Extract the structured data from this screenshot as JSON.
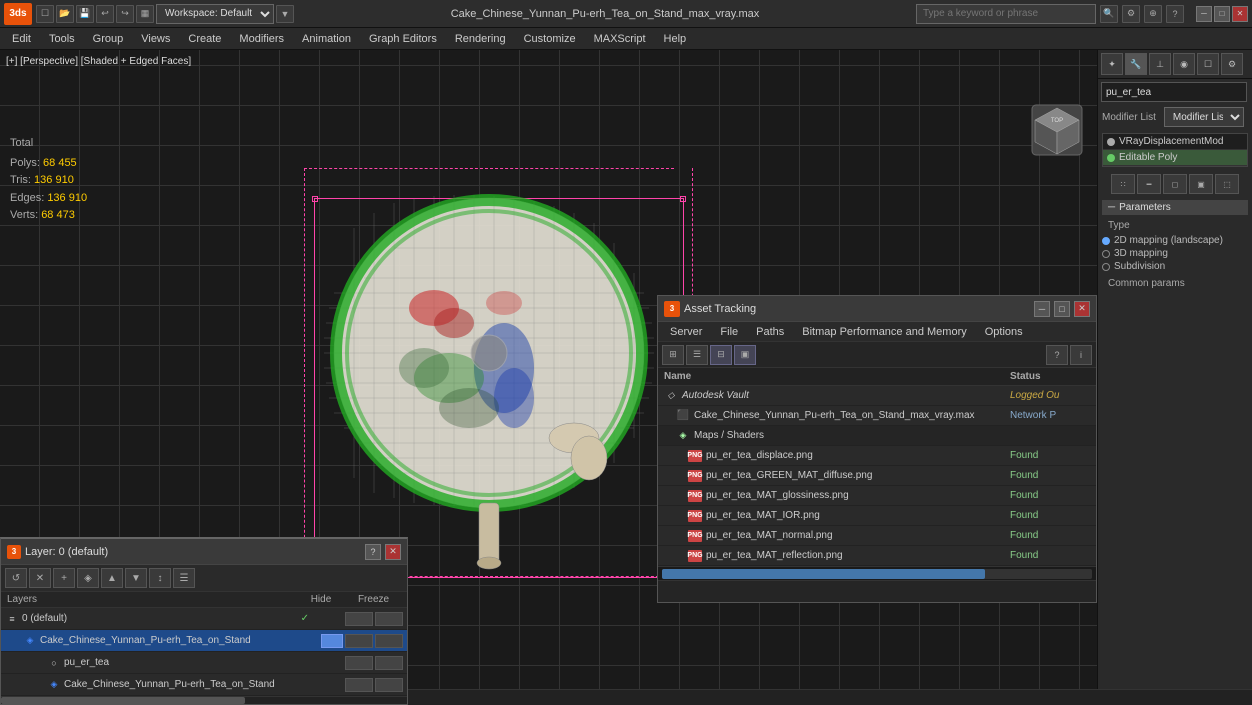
{
  "topbar": {
    "logo": "3ds",
    "workspace_label": "Workspace: Default",
    "file_title": "Cake_Chinese_Yunnan_Pu-erh_Tea_on_Stand_max_vray.max",
    "search_placeholder": "Type a keyword or phrase",
    "window_minimize": "─",
    "window_maximize": "□",
    "window_close": "✕"
  },
  "menubar": {
    "items": [
      {
        "label": "Edit"
      },
      {
        "label": "Tools"
      },
      {
        "label": "Group"
      },
      {
        "label": "Views"
      },
      {
        "label": "Create"
      },
      {
        "label": "Modifiers"
      },
      {
        "label": "Animation"
      },
      {
        "label": "Graph Editors"
      },
      {
        "label": "Rendering"
      },
      {
        "label": "Customize"
      },
      {
        "label": "MAXScript"
      },
      {
        "label": "Help"
      }
    ]
  },
  "viewport": {
    "label": "[+] [Perspective] [Shaded + Edged Faces]",
    "stats": {
      "polys_label": "Polys:",
      "polys_value": "68 455",
      "tris_label": "Tris:",
      "tris_value": "136 910",
      "edges_label": "Edges:",
      "edges_value": "136 910",
      "verts_label": "Verts:",
      "verts_value": "68 473",
      "total_label": "Total"
    }
  },
  "right_panel": {
    "modifier_name": "pu_er_tea",
    "modifier_list_label": "Modifier List",
    "stack": [
      {
        "name": "VRayDisplacementMod",
        "active": false
      },
      {
        "name": "Editable Poly",
        "active": true
      }
    ],
    "params_header": "Parameters",
    "type_label": "Type",
    "mapping_options": [
      {
        "label": "2D mapping (landscape)",
        "selected": true
      },
      {
        "label": "3D mapping",
        "selected": false
      },
      {
        "label": "Subdivision",
        "selected": false
      }
    ],
    "common_params_label": "Common params"
  },
  "layers_panel": {
    "title": "Layer: 0 (default)",
    "header": {
      "name_col": "Layers",
      "hide_col": "Hide",
      "freeze_col": "Freeze"
    },
    "items": [
      {
        "indent": 0,
        "icon": "≡",
        "name": "0 (default)",
        "check": true,
        "is_selected": false
      },
      {
        "indent": 1,
        "icon": "◈",
        "name": "Cake_Chinese_Yunnan_Pu-erh_Tea_on_Stand",
        "check": false,
        "is_selected": true
      },
      {
        "indent": 2,
        "icon": "○",
        "name": "pu_er_tea",
        "check": false,
        "is_selected": false
      },
      {
        "indent": 2,
        "icon": "◈",
        "name": "Cake_Chinese_Yunnan_Pu-erh_Tea_on_Stand",
        "check": false,
        "is_selected": false
      }
    ]
  },
  "asset_panel": {
    "title": "Asset Tracking",
    "menubar": [
      {
        "label": "Server"
      },
      {
        "label": "File"
      },
      {
        "label": "Paths"
      },
      {
        "label": "Bitmap Performance and Memory"
      },
      {
        "label": "Options"
      }
    ],
    "header": {
      "name_col": "Name",
      "status_col": "Status"
    },
    "items": [
      {
        "indent": 0,
        "type": "vault",
        "icon": "◇",
        "name": "Autodesk Vault",
        "status": "Logged Ou",
        "status_class": "status-loggedout"
      },
      {
        "indent": 1,
        "type": "file",
        "icon": "file",
        "name": "Cake_Chinese_Yunnan_Pu-erh_Tea_on_Stand_max_vray.max",
        "status": "Network P",
        "status_class": "status-network"
      },
      {
        "indent": 1,
        "type": "group",
        "icon": "◈",
        "name": "Maps / Shaders",
        "status": "",
        "status_class": ""
      },
      {
        "indent": 2,
        "type": "png",
        "icon": "PNG",
        "name": "pu_er_tea_displace.png",
        "status": "Found",
        "status_class": "status-found"
      },
      {
        "indent": 2,
        "type": "png",
        "icon": "PNG",
        "name": "pu_er_tea_GREEN_MAT_diffuse.png",
        "status": "Found",
        "status_class": "status-found"
      },
      {
        "indent": 2,
        "type": "png",
        "icon": "PNG",
        "name": "pu_er_tea_MAT_glossiness.png",
        "status": "Found",
        "status_class": "status-found"
      },
      {
        "indent": 2,
        "type": "png",
        "icon": "PNG",
        "name": "pu_er_tea_MAT_IOR.png",
        "status": "Found",
        "status_class": "status-found"
      },
      {
        "indent": 2,
        "type": "png",
        "icon": "PNG",
        "name": "pu_er_tea_MAT_normal.png",
        "status": "Found",
        "status_class": "status-found"
      },
      {
        "indent": 2,
        "type": "png",
        "icon": "PNG",
        "name": "pu_er_tea_MAT_reflection.png",
        "status": "Found",
        "status_class": "status-found"
      }
    ]
  },
  "icons": {
    "refresh": "↺",
    "add": "+",
    "delete": "✕",
    "up": "▲",
    "down": "▼",
    "lock": "🔒",
    "folder": "📁",
    "expand": "▶",
    "collapse": "▼",
    "list": "☰",
    "grid": "⊞",
    "search": "🔍",
    "help": "?",
    "settings": "⚙"
  }
}
